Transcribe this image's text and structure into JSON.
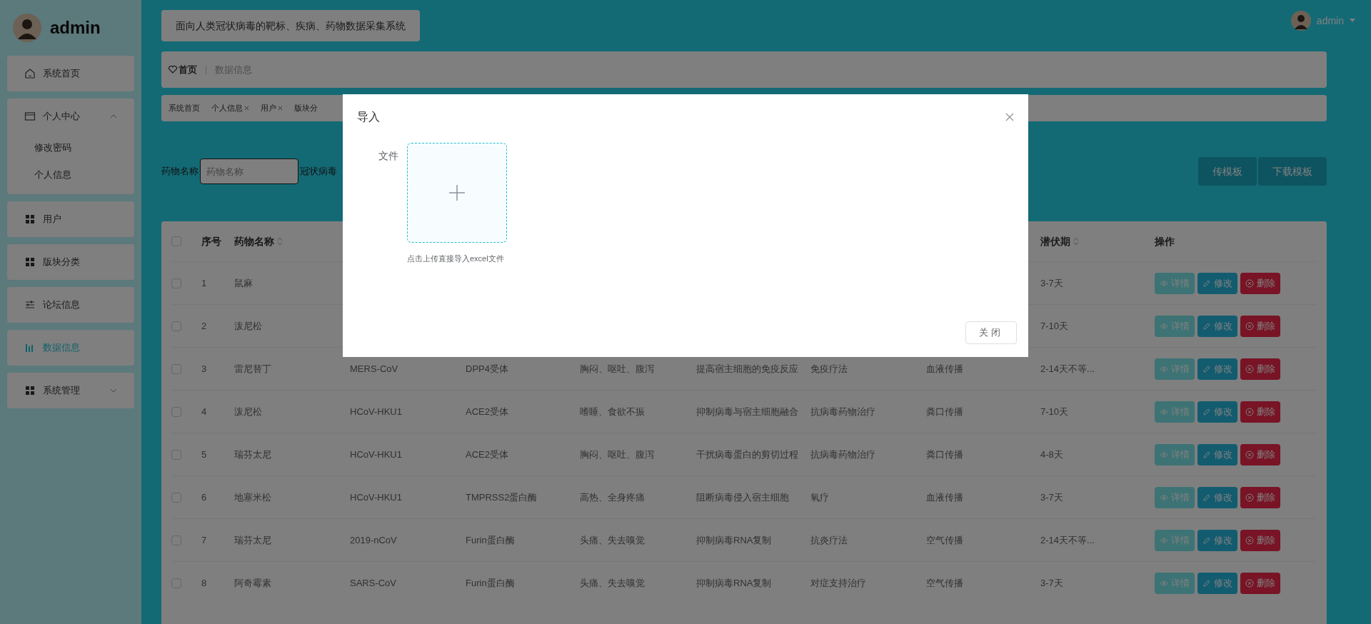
{
  "sidebar": {
    "user": "admin",
    "items": [
      {
        "label": "系统首页",
        "kind": "home",
        "selected": false
      },
      {
        "label": "个人中心",
        "kind": "card",
        "selected": false,
        "expanded": true,
        "children": [
          {
            "label": "修改密码",
            "selected": false
          },
          {
            "label": "个人信息",
            "selected": false
          }
        ]
      },
      {
        "label": "用户",
        "kind": "grid",
        "selected": false
      },
      {
        "label": "版块分类",
        "kind": "grid",
        "selected": false
      },
      {
        "label": "论坛信息",
        "kind": "sliders",
        "selected": false
      },
      {
        "label": "数据信息",
        "kind": "chart",
        "selected": true
      },
      {
        "label": "系统管理",
        "kind": "grid",
        "selected": false,
        "expanded": false
      }
    ]
  },
  "header": {
    "title": "面向人类冠状病毒的靶标、疾病、药物数据采集系统",
    "user": "admin"
  },
  "breadcrumb": [
    "首页",
    "数据信息"
  ],
  "tags": [
    {
      "label": "系统首页",
      "closable": false
    },
    {
      "label": "个人信息",
      "closable": true
    },
    {
      "label": "用户",
      "closable": true
    },
    {
      "label": "版块分",
      "closable": false
    }
  ],
  "search": {
    "fields": [
      {
        "label": "药物名称",
        "placeholder": "药物名称"
      },
      {
        "label": "冠状病毒"
      }
    ],
    "buttons": [
      "传模板",
      "下载模板"
    ]
  },
  "table": {
    "all_checked": false,
    "columns": [
      {
        "kind": "number",
        "label": "序号",
        "sortable": false
      },
      {
        "kind": "name",
        "label": "药物名称",
        "sortable": true
      },
      {
        "kind": "latency",
        "label": "潜伏期",
        "sortable": true
      },
      {
        "kind": "actions",
        "label": "操作",
        "sortable": false
      }
    ],
    "rows": [
      {
        "checked": false,
        "index": "1",
        "name": "鼠麻",
        "incubation": "3-7天",
        "actions": [
          {
            "kind": "detail",
            "label": "详情"
          },
          {
            "kind": "edit",
            "label": "修改"
          },
          {
            "kind": "delete",
            "label": "删除"
          }
        ]
      },
      {
        "checked": false,
        "index": "2",
        "name": "泼尼松",
        "incubation": "7-10天",
        "actions": [
          {
            "kind": "detail",
            "label": "详情"
          },
          {
            "kind": "edit",
            "label": "修改"
          },
          {
            "kind": "delete",
            "label": "删除"
          }
        ]
      },
      {
        "checked": false,
        "index": "3",
        "name": "雷尼替丁",
        "virus": "MERS-CoV",
        "target": "DPP4受体",
        "symptom": "胸闷、呕吐、腹泻",
        "mechanism": "提高宿主细胞的免疫反应",
        "therapy": "免疫疗法",
        "route": "血液传播",
        "incubation": "2-14天不等...",
        "actions": [
          {
            "kind": "detail",
            "label": "详情"
          },
          {
            "kind": "edit",
            "label": "修改"
          },
          {
            "kind": "delete",
            "label": "删除"
          }
        ]
      },
      {
        "checked": false,
        "index": "4",
        "name": "泼尼松",
        "virus": "HCoV-HKU1",
        "target": "ACE2受体",
        "symptom": "嗜睡、食欲不振",
        "mechanism": "抑制病毒与宿主细胞融合",
        "therapy": "抗病毒药物治疗",
        "route": "粪口传播",
        "incubation": "7-10天",
        "actions": [
          {
            "kind": "detail",
            "label": "详情"
          },
          {
            "kind": "edit",
            "label": "修改"
          },
          {
            "kind": "delete",
            "label": "删除"
          }
        ]
      },
      {
        "checked": false,
        "index": "5",
        "name": "瑞芬太尼",
        "virus": "HCoV-HKU1",
        "target": "ACE2受体",
        "symptom": "胸闷、呕吐、腹泻",
        "mechanism": "干扰病毒蛋白的剪切过程",
        "therapy": "抗病毒药物治疗",
        "route": "粪口传播",
        "incubation": "4-8天",
        "actions": [
          {
            "kind": "detail",
            "label": "详情"
          },
          {
            "kind": "edit",
            "label": "修改"
          },
          {
            "kind": "delete",
            "label": "删除"
          }
        ]
      },
      {
        "checked": false,
        "index": "6",
        "name": "地塞米松",
        "virus": "HCoV-HKU1",
        "target": "TMPRSS2蛋白酶",
        "symptom": "高热、全身疼痛",
        "mechanism": "阻断病毒侵入宿主细胞",
        "therapy": "氧疗",
        "route": "血液传播",
        "incubation": "3-7天",
        "actions": [
          {
            "kind": "detail",
            "label": "详情"
          },
          {
            "kind": "edit",
            "label": "修改"
          },
          {
            "kind": "delete",
            "label": "删除"
          }
        ]
      },
      {
        "checked": false,
        "index": "7",
        "name": "瑞芬太尼",
        "virus": "2019-nCoV",
        "target": "Furin蛋白酶",
        "symptom": "头痛、失去嗅觉",
        "mechanism": "抑制病毒RNA复制",
        "therapy": "抗炎疗法",
        "route": "空气传播",
        "incubation": "2-14天不等...",
        "actions": [
          {
            "kind": "detail",
            "label": "详情"
          },
          {
            "kind": "edit",
            "label": "修改"
          },
          {
            "kind": "delete",
            "label": "删除"
          }
        ]
      },
      {
        "checked": false,
        "index": "8",
        "name": "阿奇霉素",
        "virus": "SARS-CoV",
        "target": "Furin蛋白酶",
        "symptom": "头痛、失去嗅觉",
        "mechanism": "抑制病毒RNA复制",
        "therapy": "对症支持治疗",
        "route": "空气传播",
        "incubation": "3-7天",
        "actions": [
          {
            "kind": "detail",
            "label": "详情"
          },
          {
            "kind": "edit",
            "label": "修改"
          },
          {
            "kind": "delete",
            "label": "删除"
          }
        ]
      }
    ]
  },
  "modal": {
    "title": "导入",
    "field_label": "文件",
    "hint": "点击上传直接导入excel文件",
    "buttons": [
      "关闭"
    ]
  }
}
